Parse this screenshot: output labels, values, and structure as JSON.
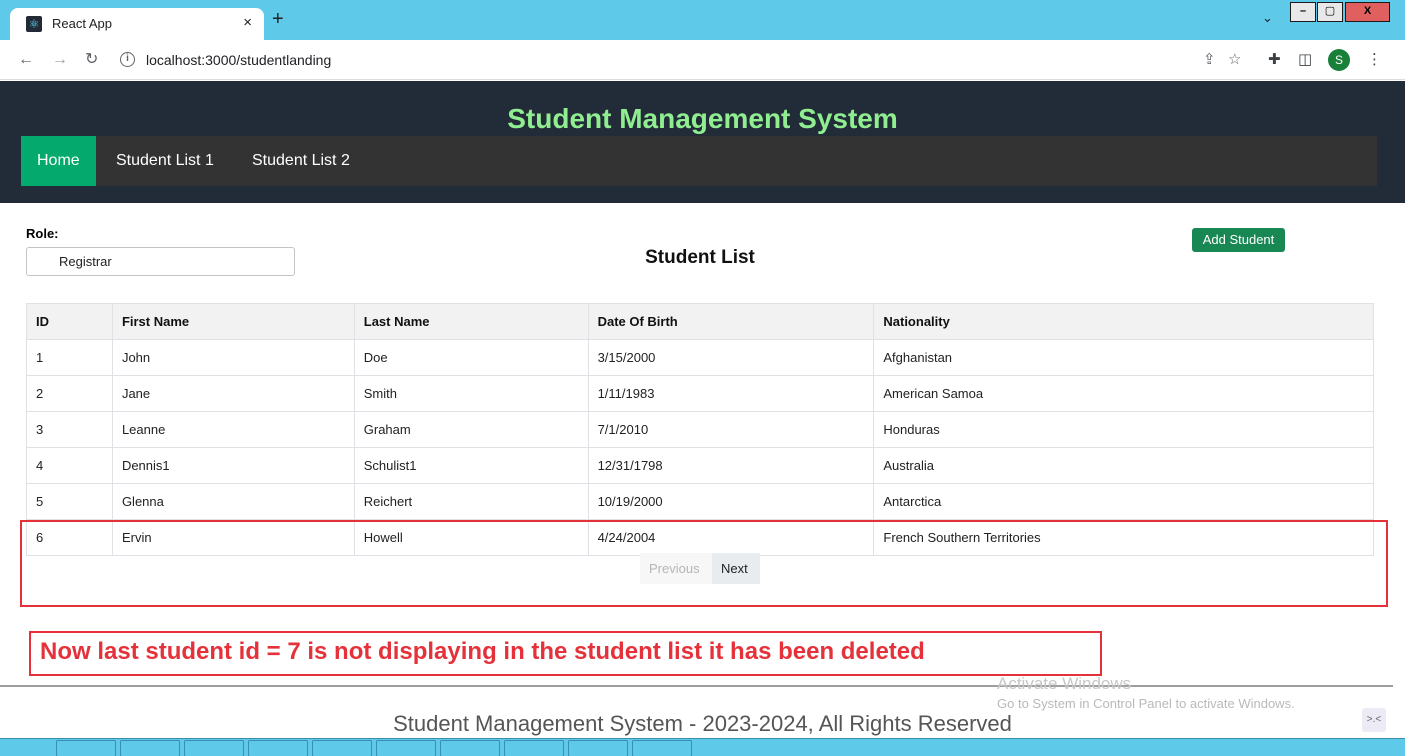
{
  "browser": {
    "tab_title": "React App",
    "tab_close": "×",
    "new_tab": "+",
    "url": "localhost:3000/studentlanding",
    "profile_initial": "S",
    "window_minimize": "–",
    "window_restore": "▢",
    "window_close": "X"
  },
  "app": {
    "title": "Student Management System",
    "nav": [
      "Home",
      "Student List 1",
      "Student List 2"
    ],
    "active_nav": "Home"
  },
  "page": {
    "role_label": "Role:",
    "role_value": "Registrar",
    "heading": "Student List",
    "add_button": "Add Student"
  },
  "table": {
    "headers": [
      "ID",
      "First Name",
      "Last Name",
      "Date Of Birth",
      "Nationality"
    ],
    "rows": [
      [
        "1",
        "John",
        "Doe",
        "3/15/2000",
        "Afghanistan"
      ],
      [
        "2",
        "Jane",
        "Smith",
        "1/11/1983",
        "American Samoa"
      ],
      [
        "3",
        "Leanne",
        "Graham",
        "7/1/2010",
        "Honduras"
      ],
      [
        "4",
        "Dennis1",
        "Schulist1",
        "12/31/1798",
        "Australia"
      ],
      [
        "5",
        "Glenna",
        "Reichert",
        "10/19/2000",
        "Antarctica"
      ],
      [
        "6",
        "Ervin",
        "Howell",
        "4/24/2004",
        "French Southern Territories"
      ]
    ]
  },
  "pagination": {
    "previous": "Previous",
    "next": "Next"
  },
  "annotation": "Now last student id = 7 is not displaying in the student list it has been deleted",
  "footer": "Student Management System - 2023-2024, All Rights Reserved",
  "watermark": {
    "title": "Activate Windows",
    "subtitle": "Go to System in Control Panel to activate Windows."
  },
  "colors": {
    "header_bg": "#222b38",
    "title": "#90ee90",
    "active_nav": "#04aa6d",
    "add_button": "#198754",
    "annotation": "#e5323a"
  }
}
